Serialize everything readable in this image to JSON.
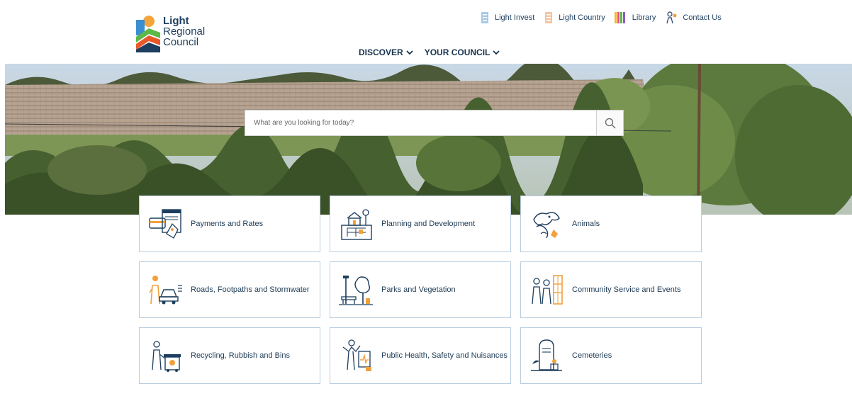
{
  "brand": {
    "logo_line1": "Light",
    "logo_line2": "Regional",
    "logo_line3": "Council"
  },
  "top_links": [
    {
      "label": "Light Invest",
      "icon": "light-invest-icon"
    },
    {
      "label": "Light Country",
      "icon": "light-country-icon"
    },
    {
      "label": "Library",
      "icon": "library-icon"
    },
    {
      "label": "Contact Us",
      "icon": "contact-icon"
    }
  ],
  "nav": {
    "discover": "DISCOVER",
    "council": "YOUR COUNCIL"
  },
  "search": {
    "placeholder": "What are you looking for today?"
  },
  "cards": [
    {
      "label": "Payments and Rates",
      "icon": "payments-icon"
    },
    {
      "label": "Planning and Development",
      "icon": "planning-icon"
    },
    {
      "label": "Animals",
      "icon": "animals-icon"
    },
    {
      "label": "Roads, Footpaths and Stormwater",
      "icon": "roads-icon"
    },
    {
      "label": "Parks and Vegetation",
      "icon": "parks-icon"
    },
    {
      "label": "Community Service and Events",
      "icon": "community-icon"
    },
    {
      "label": "Recycling, Rubbish and Bins",
      "icon": "recycling-icon"
    },
    {
      "label": "Public Health, Safety and Nuisances",
      "icon": "public-health-icon"
    },
    {
      "label": "Cemeteries",
      "icon": "cemeteries-icon"
    }
  ],
  "colors": {
    "navy": "#1d3e5e",
    "accent_orange": "#f2a03d",
    "card_border": "#b9cde0"
  }
}
